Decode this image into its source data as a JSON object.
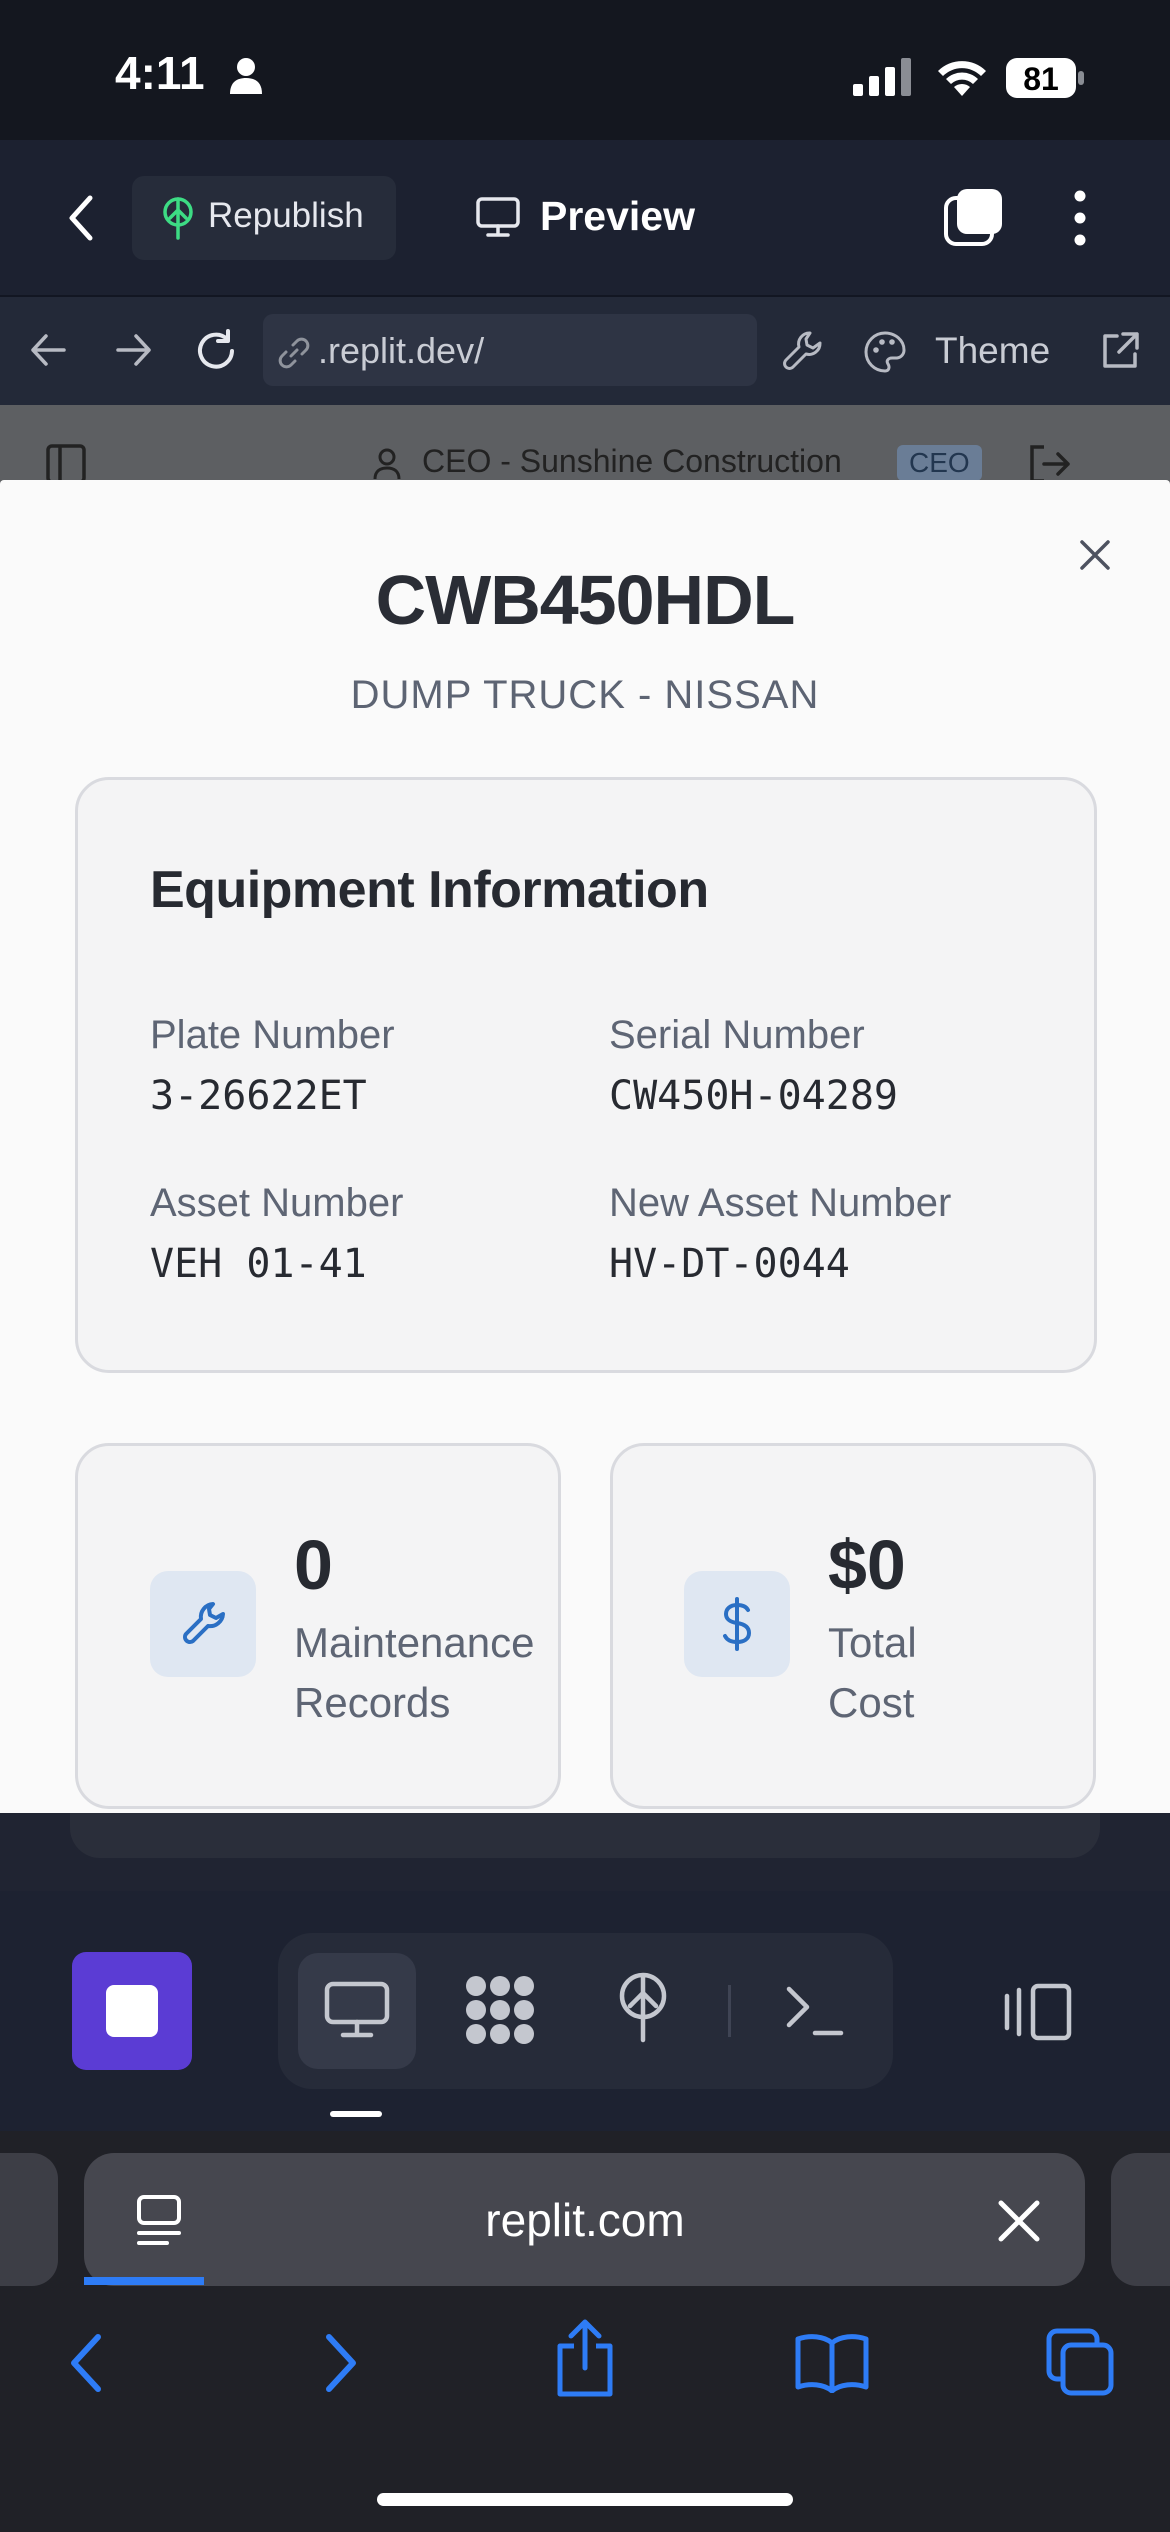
{
  "status_bar": {
    "time": "4:11",
    "battery": "81"
  },
  "replit_header": {
    "republish_label": "Republish",
    "preview_label": "Preview"
  },
  "url_bar": {
    "url": ".replit.dev/",
    "theme_label": "Theme"
  },
  "app_header_behind": {
    "user_text": "CEO - Sunshine Construction",
    "role_badge": "CEO"
  },
  "modal": {
    "title": "CWB450HDL",
    "subtitle": "DUMP TRUCK - NISSAN",
    "info_heading": "Equipment Information",
    "fields": [
      {
        "label": "Plate Number",
        "value": "3-26622ET"
      },
      {
        "label": "Serial Number",
        "value": "CW450H-04289"
      },
      {
        "label": "Asset Number",
        "value": "VEH 01-41"
      },
      {
        "label": "New Asset Number",
        "value": "HV-DT-0044"
      }
    ],
    "stats": [
      {
        "value": "0",
        "label_line1": "Maintenance",
        "label_line2": "Records",
        "icon": "wrench-icon"
      },
      {
        "value": "$0",
        "label_line1": "Total",
        "label_line2": "Cost",
        "icon": "dollar-icon"
      }
    ]
  },
  "safari": {
    "tab_url": "replit.com"
  },
  "colors": {
    "accent_blue": "#2e7cf6",
    "stop_purple": "#5b3cd4",
    "icon_blue": "#2a6fc4"
  }
}
